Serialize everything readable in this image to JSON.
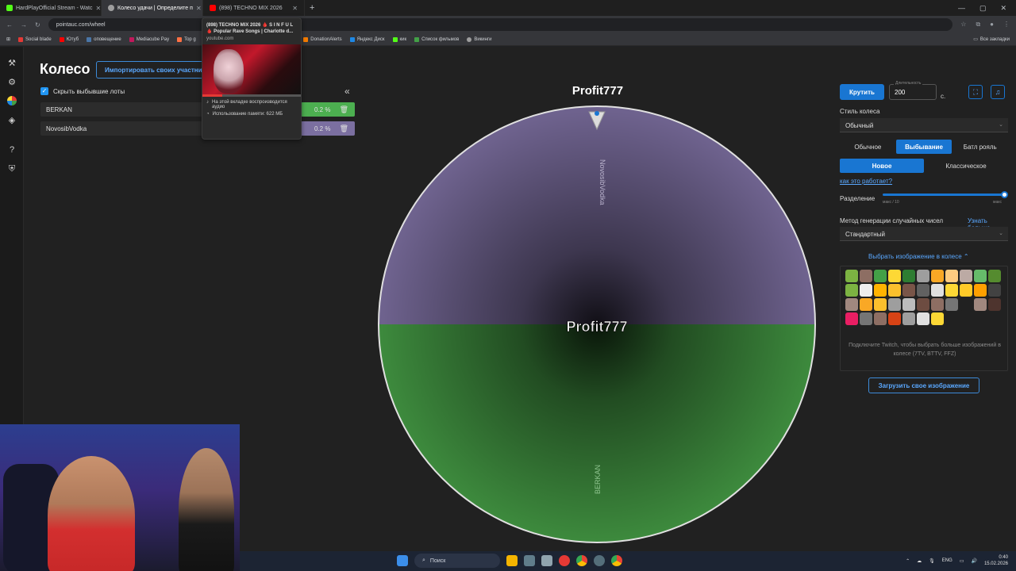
{
  "browser": {
    "tabs": [
      {
        "label": "HardPlayOfficial Stream - Watc",
        "color": "#53fc18",
        "active": false
      },
      {
        "label": "Колесо удачи | Определите п",
        "color": "#9e9e9e",
        "active": true
      },
      {
        "label": "(898) TECHNO MIX 2026",
        "color": "#ff0000",
        "active": false
      }
    ],
    "new_tab": "+",
    "url": "pointauc.com/wheel",
    "bookmarks": [
      "Social blade",
      "Ютуб",
      "оповещение",
      "Mediacube Pay",
      "Top g",
      "ВК",
      "DonationAlerts",
      "Яндекс Диск",
      "кик",
      "Список фильмов",
      "Викинги"
    ],
    "all_bookmarks": "Все закладки"
  },
  "tab_preview": {
    "title": "(898) TECHNO MIX 2026 🩸 S I N F U L 🩸 Popular Rave Songs | Charlotte d...",
    "site": "youtube.com",
    "audio_note": "На этой вкладке воспроизводится аудио",
    "memory_note": "Использование памяти: 622 МБ"
  },
  "left": {
    "title": "Колесо",
    "import_button": "Импортировать своих участников",
    "hide_checkbox": "Скрыть выбывшие лоты",
    "collapse": "«",
    "lots": [
      {
        "name": "BERKAN",
        "percent": "0.2 %",
        "color": "#4caf50"
      },
      {
        "name": "NovosibVodka",
        "percent": "0.2 %",
        "color": "#7b6fa0"
      }
    ]
  },
  "wheel": {
    "winner": "Profit777",
    "center_label": "Profit777",
    "segments": [
      {
        "name": "NovosibVodka",
        "color": "#6f638f"
      },
      {
        "name": "BERKAN",
        "color": "#3d8a3d"
      }
    ]
  },
  "right": {
    "spin_button": "Крутить",
    "duration_label": "Длительность",
    "duration_value": "200",
    "duration_unit": "с.",
    "style_label": "Стиль колеса",
    "style_value": "Обычный",
    "modes": [
      "Обычное",
      "Выбывание",
      "Батл рояль"
    ],
    "active_mode": "Выбывание",
    "submodes": [
      "Новое",
      "Классическое"
    ],
    "active_submode": "Новое",
    "how_link": "как это работает?",
    "split_label": "Разделение",
    "split_min": "макс / 10",
    "split_max": "макс",
    "split_level": 1.0,
    "rng_label": "Метод генерации случайных чисел",
    "rng_link": "Узнать больше",
    "rng_value": "Стандартный",
    "image_toggle": "Выбрать изображение в колесе ⌃",
    "twitch_note": "Подключите Twitch, чтобы выбрать больше изображений в колесе (7TV, BTTV, FFZ)",
    "upload_button": "Загрузить свое изображение"
  },
  "taskbar": {
    "search": "Поиск",
    "lang": "ENG",
    "time": "0:40",
    "date": "15.02.2026"
  }
}
